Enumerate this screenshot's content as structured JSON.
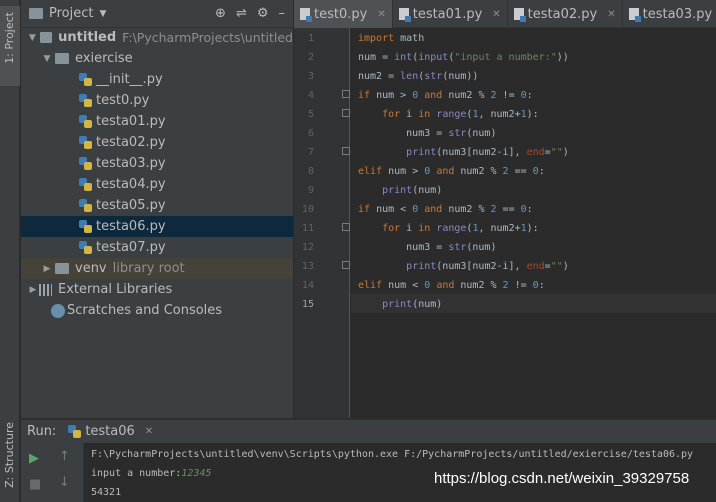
{
  "left_toolbar": {
    "project_tab": "1: Project",
    "structure_tab": "Z: Structure"
  },
  "project_panel": {
    "title": "Project",
    "tree": {
      "root": {
        "name": "untitled",
        "path": "F:\\PycharmProjects\\untitled"
      },
      "folder": {
        "name": "exiercise"
      },
      "files": [
        "__init__.py",
        "test0.py",
        "testa01.py",
        "testa02.py",
        "testa03.py",
        "testa04.py",
        "testa05.py",
        "testa06.py",
        "testa07.py"
      ],
      "selected_file": "testa06.py",
      "venv": {
        "name": "venv",
        "suffix": "library root"
      },
      "external_libraries": "External Libraries",
      "scratches": "Scratches and Consoles"
    }
  },
  "editor_tabs": [
    "test0.py",
    "testa01.py",
    "testa02.py",
    "testa03.py"
  ],
  "editor": {
    "line_numbers": [
      "1",
      "2",
      "3",
      "4",
      "5",
      "6",
      "7",
      "8",
      "9",
      "10",
      "11",
      "12",
      "13",
      "14",
      "15"
    ],
    "current_line": "15"
  },
  "run_panel": {
    "label": "Run:",
    "config": "testa06",
    "command": "F:\\PycharmProjects\\untitled\\venv\\Scripts\\python.exe F:/PycharmProjects/untitled/exiercise/testa06.py",
    "prompt": "input a number:",
    "user_input": "12345",
    "output": "54321"
  },
  "watermark": "https://blog.csdn.net/weixin_39329758",
  "colors": {
    "keyword": "#cc7832",
    "builtin": "#8888c6",
    "string": "#6a8759",
    "number": "#6897bb",
    "param": "#aa4926",
    "selected_row": "#0d293e"
  }
}
